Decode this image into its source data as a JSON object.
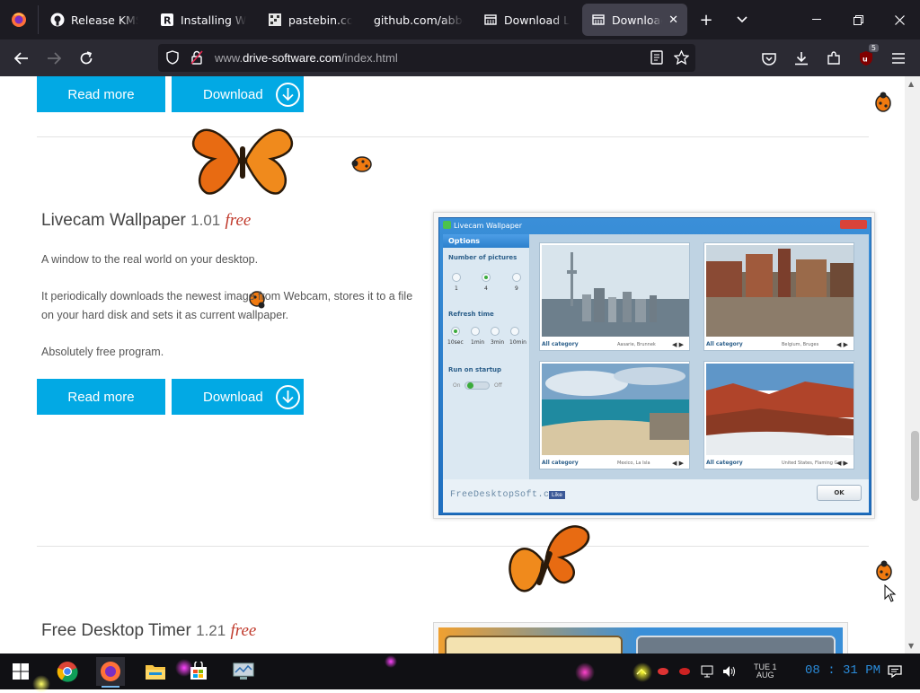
{
  "browser": {
    "tabs": [
      {
        "label": "Release KMS",
        "icon": "github-icon"
      },
      {
        "label": "Installing Wind",
        "icon": "r-icon"
      },
      {
        "label": "pastebin.com/",
        "icon": "pastebin-icon"
      },
      {
        "label": "github.com/abbod",
        "icon": "none"
      },
      {
        "label": "Download Lad",
        "icon": "page-icon"
      },
      {
        "label": "Download A",
        "icon": "page-icon"
      }
    ],
    "url_prefix": "www.",
    "url_domain": "drive-software.com",
    "url_path": "/index.html",
    "extension_badge": "5"
  },
  "page": {
    "buttons": {
      "read_more": "Read more",
      "download": "Download"
    },
    "product1": {
      "name": "Livecam Wallpaper",
      "version": "1.01",
      "price": "free",
      "desc1": "A window to the real world on your desktop.",
      "desc2": "It periodically downloads the newest image from Webcam, stores it to a file on your hard disk and sets it as current wallpaper.",
      "desc3": "Absolutely free program."
    },
    "screenshot": {
      "window_title": "Livecam Wallpaper",
      "options_header": "Options",
      "number_label": "Number of pictures",
      "number_options": [
        "1",
        "4",
        "9"
      ],
      "refresh_label": "Refresh time",
      "refresh_options": [
        "10sec",
        "1min",
        "3min",
        "10min"
      ],
      "startup_label": "Run on startup",
      "toggle_on": "On",
      "toggle_off": "Off",
      "pictures": [
        {
          "category": "All category",
          "location": "Aasarie, Brunnek"
        },
        {
          "category": "All category",
          "location": "Belgium, Bruges"
        },
        {
          "category": "All category",
          "location": "Mexico, La Isla"
        },
        {
          "category": "All category",
          "location": "United States, Flaming Gorg"
        }
      ],
      "brand": "FreeDesktopSoft.com",
      "like": "Like",
      "ok": "OK"
    },
    "product2": {
      "name": "Free Desktop Timer",
      "version": "1.21",
      "price": "free"
    }
  },
  "taskbar": {
    "day": "TUE",
    "month": "AUG",
    "date": "1",
    "time": "08 : 31 PM"
  }
}
